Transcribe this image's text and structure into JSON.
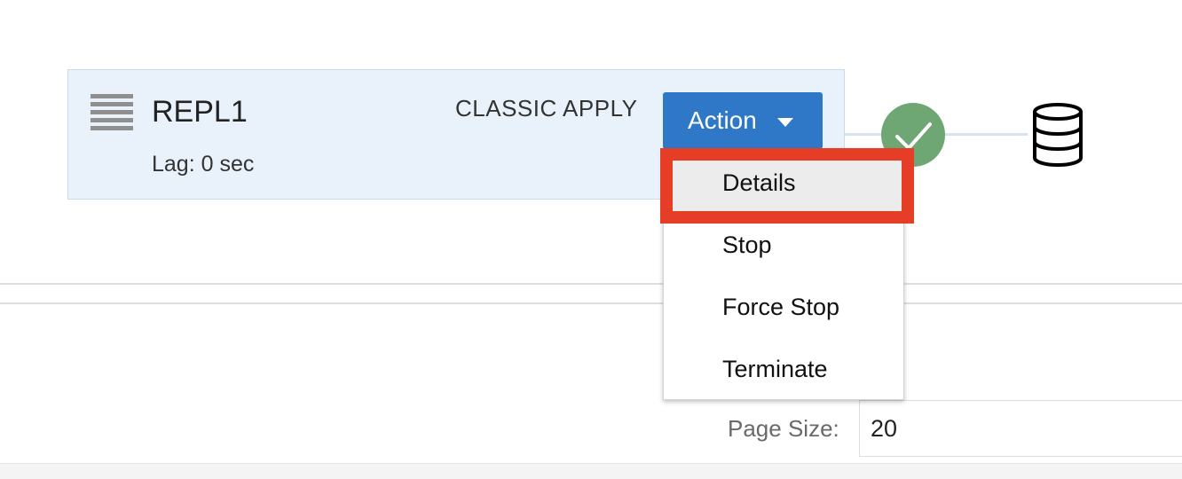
{
  "process": {
    "name": "REPL1",
    "lag": "Lag: 0 sec",
    "type": "CLASSIC APPLY",
    "action_label": "Action"
  },
  "status": {
    "icon": "check-icon",
    "color": "#6ea674"
  },
  "target": {
    "icon": "database-icon"
  },
  "menu": {
    "items": [
      {
        "label": "Details",
        "highlighted": true
      },
      {
        "label": "Stop"
      },
      {
        "label": "Force Stop"
      },
      {
        "label": "Terminate"
      }
    ]
  },
  "pagination": {
    "page_size_label": "Page Size:",
    "page_size_value": "20"
  },
  "colors": {
    "accent": "#2f78c8",
    "callout": "#e63e26",
    "card_bg": "#e9f1fa"
  }
}
